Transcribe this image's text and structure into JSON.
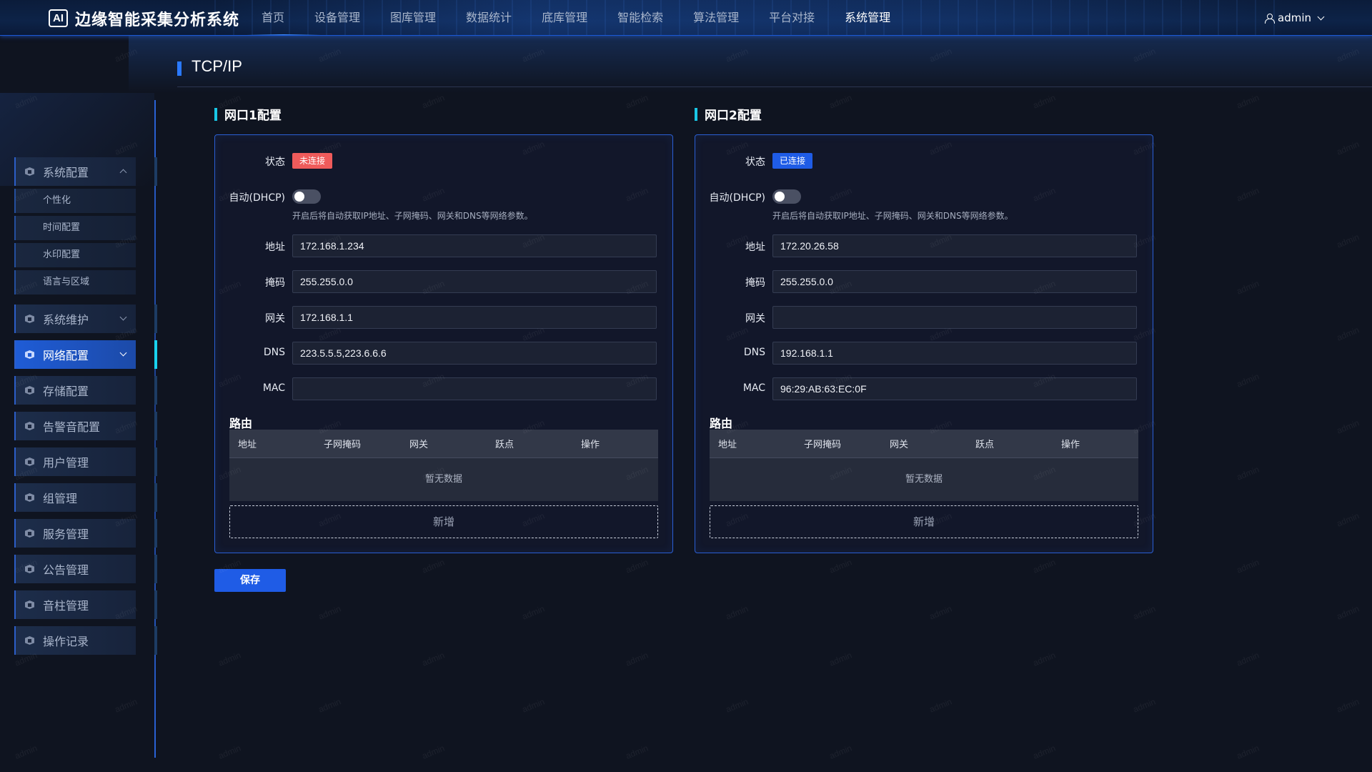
{
  "app": {
    "logo": "AI",
    "title": "边缘智能采集分析系统"
  },
  "nav": [
    "首页",
    "设备管理",
    "图库管理",
    "数据统计",
    "底库管理",
    "智能检索",
    "算法管理",
    "平台对接",
    "系统管理"
  ],
  "user": {
    "name": "admin"
  },
  "sidebar": {
    "groups": [
      {
        "label": "系统配置",
        "expanded": true,
        "children": [
          "个性化",
          "时间配置",
          "水印配置",
          "语言与区域"
        ]
      },
      {
        "label": "系统维护"
      },
      {
        "label": "网络配置",
        "active": true
      },
      {
        "label": "存储配置"
      },
      {
        "label": "告警音配置"
      },
      {
        "label": "用户管理"
      },
      {
        "label": "组管理"
      },
      {
        "label": "服务管理"
      },
      {
        "label": "公告管理"
      },
      {
        "label": "音柱管理"
      },
      {
        "label": "操作记录"
      }
    ]
  },
  "page": {
    "title": "TCP/IP"
  },
  "labels": {
    "status": "状态",
    "dhcp": "自动(DHCP)",
    "dhcp_hint": "开启后将自动获取IP地址、子网掩码、网关和DNS等网络参数。",
    "address": "地址",
    "mask": "掩码",
    "gateway": "网关",
    "dns": "DNS",
    "mac": "MAC",
    "route": "路由",
    "route_cols": [
      "地址",
      "子网掩码",
      "网关",
      "跃点",
      "操作"
    ],
    "empty": "暂无数据",
    "add": "新增",
    "save": "保存"
  },
  "ports": [
    {
      "title": "网口1配置",
      "status": "未连接",
      "status_color": "#ef5b5b",
      "dhcp": false,
      "address": "172.168.1.234",
      "mask": "255.255.0.0",
      "gateway": "172.168.1.1",
      "dns": "223.5.5.5,223.6.6.6",
      "mac": ""
    },
    {
      "title": "网口2配置",
      "status": "已连接",
      "status_color": "#1f5ce6",
      "dhcp": false,
      "address": "172.20.26.58",
      "mask": "255.255.0.0",
      "gateway": "",
      "dns": "192.168.1.1",
      "mac": "96:29:AB:63:EC:0F"
    }
  ],
  "watermark": "admin",
  "colors": {
    "accent": "#1f5ce6",
    "active_bar": "#19d3ee",
    "panel_border": "#2a5fd4"
  }
}
